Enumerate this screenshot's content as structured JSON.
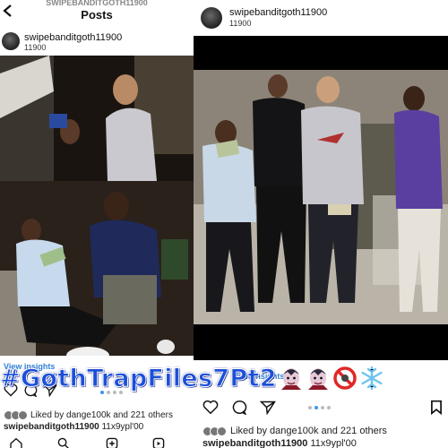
{
  "left_post": {
    "top_username": "SWIPEBANDITGOTH11900",
    "header_title": "Posts",
    "username": "swipebanditgoth11900",
    "subline": "11900",
    "insights_label": "View insights",
    "likes_text": "Liked by dange100k and 221 others",
    "caption_user": "swipebanditgoth11900",
    "caption_text": "11x9ypl'00"
  },
  "right_post": {
    "username": "swipebanditgoth11900",
    "subline": "11900",
    "insights_label": "View insights",
    "likes_text": "Liked by dange100k and 221 others",
    "caption_user": "swipebanditgoth11900",
    "caption_text": "11x9ypl'00"
  },
  "overlay_caption": "#GøthTrapFiles7Pt2",
  "overlay_emojis": [
    "vampire-man",
    "vampire-man",
    "prohibited",
    "snowflake"
  ],
  "colors": {
    "instagram_blue": "#3897f0",
    "overlay_text": "#1c4fd8",
    "dark_stripe": "#000000"
  }
}
